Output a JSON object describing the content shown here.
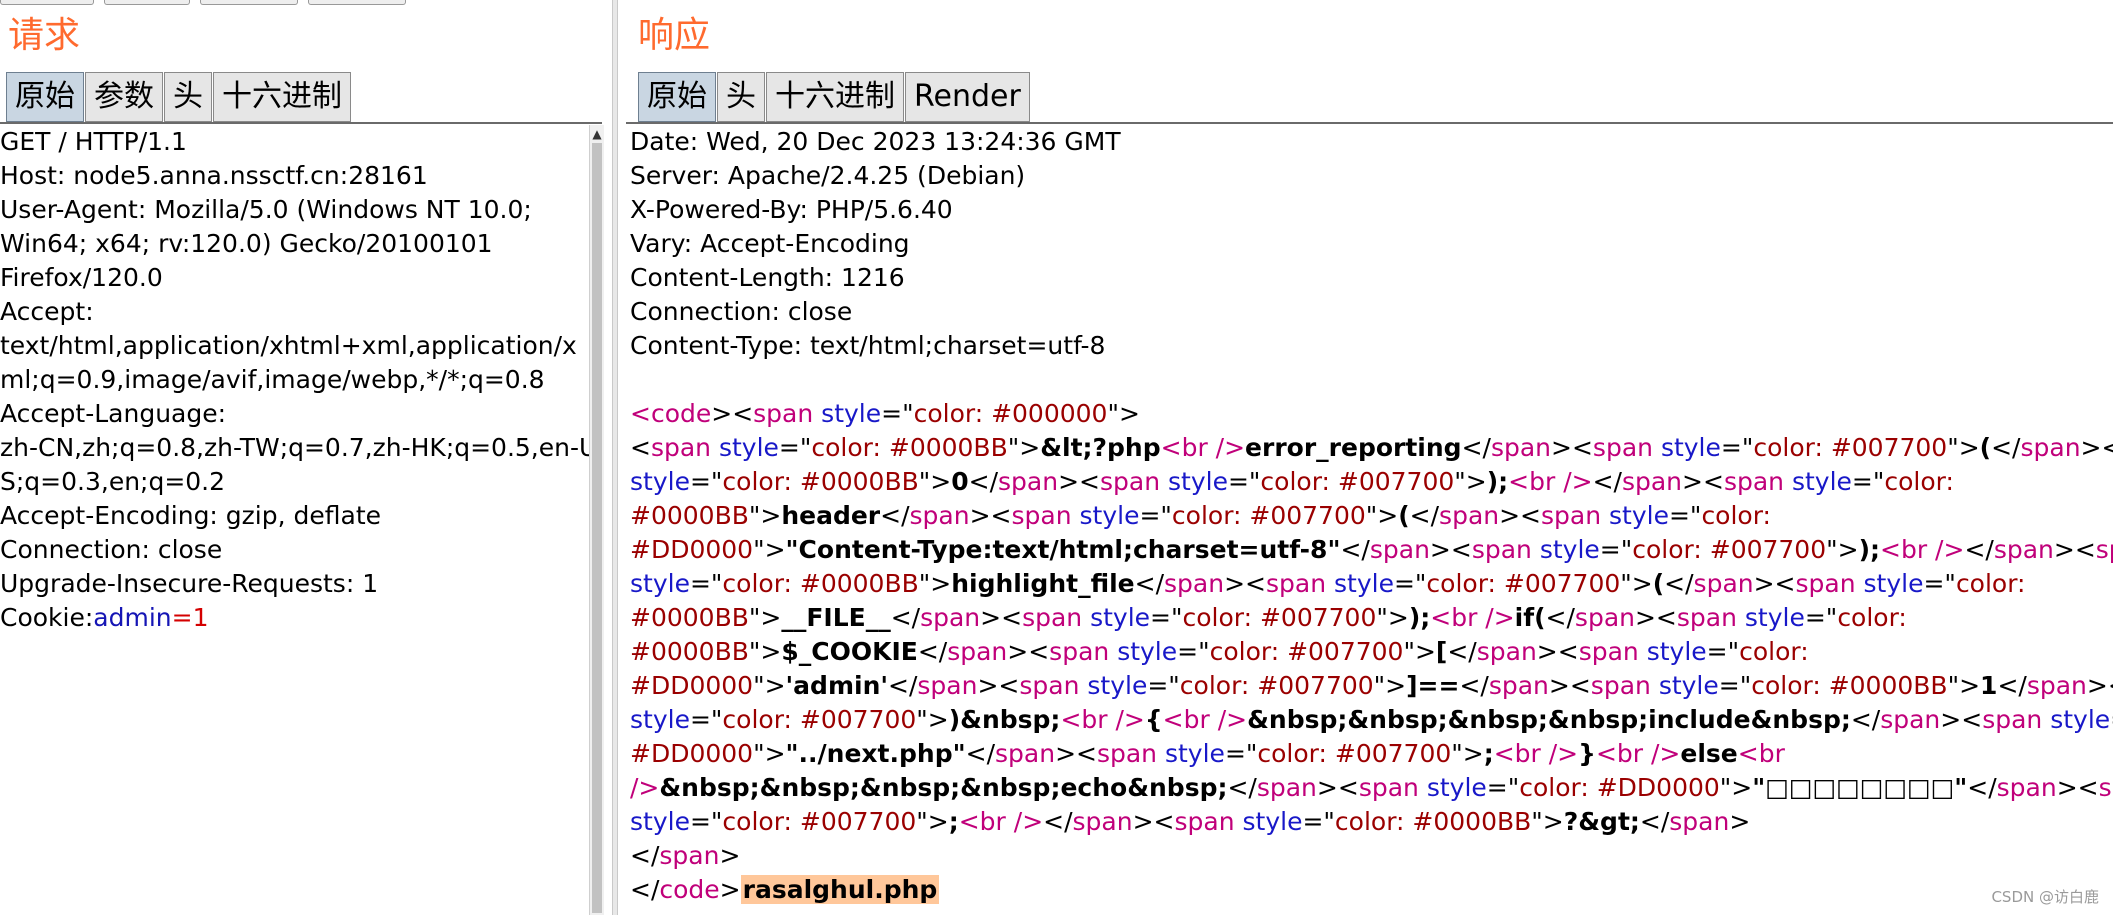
{
  "request": {
    "title": "请求",
    "tabs": [
      "原始",
      "参数",
      "头",
      "十六进制"
    ],
    "active_tab": "原始",
    "lines": [
      "GET / HTTP/1.1",
      "Host: node5.anna.nssctf.cn:28161",
      "User-Agent: Mozilla/5.0 (Windows NT 10.0;",
      "Win64; x64; rv:120.0) Gecko/20100101",
      "Firefox/120.0",
      "Accept:",
      "text/html,application/xhtml+xml,application/x",
      "ml;q=0.9,image/avif,image/webp,*/*;q=0.8",
      "Accept-Language:",
      "zh-CN,zh;q=0.8,zh-TW;q=0.7,zh-HK;q=0.5,en-U",
      "S;q=0.3,en;q=0.2",
      "Accept-Encoding: gzip, deflate",
      "Connection: close",
      "Upgrade-Insecure-Requests: 1"
    ],
    "cookie": {
      "label": "Cookie:",
      "key": "admin",
      "eq": "=",
      "value": "1"
    }
  },
  "response": {
    "title": "响应",
    "tabs": [
      "原始",
      "头",
      "十六进制",
      "Render"
    ],
    "active_tab": "原始",
    "headers": [
      "Date: Wed, 20 Dec 2023 13:24:36 GMT",
      "Server: Apache/2.4.25 (Debian)",
      "X-Powered-By: PHP/5.6.40",
      "Vary: Accept-Encoding",
      "Content-Length: 1216",
      "Connection: close",
      "Content-Type: text/html;charset=utf-8"
    ],
    "body_lines": [
      [
        [
          "t",
          "<code"
        ],
        [
          "p",
          "><"
        ],
        [
          "t",
          "span "
        ],
        [
          "a",
          "style"
        ],
        [
          "p",
          "=\""
        ],
        [
          "s",
          "color: #000000"
        ],
        [
          "p",
          "\">"
        ]
      ],
      [
        [
          "p",
          "<"
        ],
        [
          "t",
          "span "
        ],
        [
          "a",
          "style"
        ],
        [
          "p",
          "=\""
        ],
        [
          "s",
          "color: #0000BB"
        ],
        [
          "p",
          "\">"
        ],
        [
          "b",
          "&lt;?php"
        ],
        [
          "t",
          "<br />"
        ],
        [
          "b",
          "error_reporting"
        ],
        [
          "p",
          "</"
        ],
        [
          "t",
          "span"
        ],
        [
          "p",
          "><"
        ],
        [
          "t",
          "span "
        ],
        [
          "a",
          "style"
        ],
        [
          "p",
          "=\""
        ],
        [
          "s",
          "color: #007700"
        ],
        [
          "p",
          "\">"
        ],
        [
          "b",
          "("
        ],
        [
          "p",
          "</"
        ],
        [
          "t",
          "span"
        ],
        [
          "p",
          "><"
        ],
        [
          "t",
          "span"
        ]
      ],
      [
        [
          "a",
          "style"
        ],
        [
          "p",
          "=\""
        ],
        [
          "s",
          "color: #0000BB"
        ],
        [
          "p",
          "\">"
        ],
        [
          "b",
          "0"
        ],
        [
          "p",
          "</"
        ],
        [
          "t",
          "span"
        ],
        [
          "p",
          "><"
        ],
        [
          "t",
          "span "
        ],
        [
          "a",
          "style"
        ],
        [
          "p",
          "=\""
        ],
        [
          "s",
          "color: #007700"
        ],
        [
          "p",
          "\">"
        ],
        [
          "b",
          ");"
        ],
        [
          "t",
          "<br />"
        ],
        [
          "p",
          "</"
        ],
        [
          "t",
          "span"
        ],
        [
          "p",
          "><"
        ],
        [
          "t",
          "span "
        ],
        [
          "a",
          "style"
        ],
        [
          "p",
          "=\""
        ],
        [
          "s",
          "color:"
        ]
      ],
      [
        [
          "s",
          "#0000BB"
        ],
        [
          "p",
          "\">"
        ],
        [
          "b",
          "header"
        ],
        [
          "p",
          "</"
        ],
        [
          "t",
          "span"
        ],
        [
          "p",
          "><"
        ],
        [
          "t",
          "span "
        ],
        [
          "a",
          "style"
        ],
        [
          "p",
          "=\""
        ],
        [
          "s",
          "color: #007700"
        ],
        [
          "p",
          "\">"
        ],
        [
          "b",
          "("
        ],
        [
          "p",
          "</"
        ],
        [
          "t",
          "span"
        ],
        [
          "p",
          "><"
        ],
        [
          "t",
          "span "
        ],
        [
          "a",
          "style"
        ],
        [
          "p",
          "=\""
        ],
        [
          "s",
          "color:"
        ]
      ],
      [
        [
          "s",
          "#DD0000"
        ],
        [
          "p",
          "\">"
        ],
        [
          "b",
          "\"Content-Type:text/html;charset=utf-8\""
        ],
        [
          "p",
          "</"
        ],
        [
          "t",
          "span"
        ],
        [
          "p",
          "><"
        ],
        [
          "t",
          "span "
        ],
        [
          "a",
          "style"
        ],
        [
          "p",
          "=\""
        ],
        [
          "s",
          "color: #007700"
        ],
        [
          "p",
          "\">"
        ],
        [
          "b",
          ");"
        ],
        [
          "t",
          "<br />"
        ],
        [
          "p",
          "</"
        ],
        [
          "t",
          "span"
        ],
        [
          "p",
          "><"
        ],
        [
          "t",
          "span"
        ]
      ],
      [
        [
          "a",
          "style"
        ],
        [
          "p",
          "=\""
        ],
        [
          "s",
          "color: #0000BB"
        ],
        [
          "p",
          "\">"
        ],
        [
          "b",
          "highlight_file"
        ],
        [
          "p",
          "</"
        ],
        [
          "t",
          "span"
        ],
        [
          "p",
          "><"
        ],
        [
          "t",
          "span "
        ],
        [
          "a",
          "style"
        ],
        [
          "p",
          "=\""
        ],
        [
          "s",
          "color: #007700"
        ],
        [
          "p",
          "\">"
        ],
        [
          "b",
          "("
        ],
        [
          "p",
          "</"
        ],
        [
          "t",
          "span"
        ],
        [
          "p",
          "><"
        ],
        [
          "t",
          "span "
        ],
        [
          "a",
          "style"
        ],
        [
          "p",
          "=\""
        ],
        [
          "s",
          "color:"
        ]
      ],
      [
        [
          "s",
          "#0000BB"
        ],
        [
          "p",
          "\">"
        ],
        [
          "b",
          "__FILE__"
        ],
        [
          "p",
          "</"
        ],
        [
          "t",
          "span"
        ],
        [
          "p",
          "><"
        ],
        [
          "t",
          "span "
        ],
        [
          "a",
          "style"
        ],
        [
          "p",
          "=\""
        ],
        [
          "s",
          "color: #007700"
        ],
        [
          "p",
          "\">"
        ],
        [
          "b",
          ");"
        ],
        [
          "t",
          "<br />"
        ],
        [
          "b",
          "if("
        ],
        [
          "p",
          "</"
        ],
        [
          "t",
          "span"
        ],
        [
          "p",
          "><"
        ],
        [
          "t",
          "span "
        ],
        [
          "a",
          "style"
        ],
        [
          "p",
          "=\""
        ],
        [
          "s",
          "color:"
        ]
      ],
      [
        [
          "s",
          "#0000BB"
        ],
        [
          "p",
          "\">"
        ],
        [
          "b",
          "$_COOKIE"
        ],
        [
          "p",
          "</"
        ],
        [
          "t",
          "span"
        ],
        [
          "p",
          "><"
        ],
        [
          "t",
          "span "
        ],
        [
          "a",
          "style"
        ],
        [
          "p",
          "=\""
        ],
        [
          "s",
          "color: #007700"
        ],
        [
          "p",
          "\">"
        ],
        [
          "b",
          "["
        ],
        [
          "p",
          "</"
        ],
        [
          "t",
          "span"
        ],
        [
          "p",
          "><"
        ],
        [
          "t",
          "span "
        ],
        [
          "a",
          "style"
        ],
        [
          "p",
          "=\""
        ],
        [
          "s",
          "color:"
        ]
      ],
      [
        [
          "s",
          "#DD0000"
        ],
        [
          "p",
          "\">"
        ],
        [
          "b",
          "'admin'"
        ],
        [
          "p",
          "</"
        ],
        [
          "t",
          "span"
        ],
        [
          "p",
          "><"
        ],
        [
          "t",
          "span "
        ],
        [
          "a",
          "style"
        ],
        [
          "p",
          "=\""
        ],
        [
          "s",
          "color: #007700"
        ],
        [
          "p",
          "\">"
        ],
        [
          "b",
          "]=="
        ],
        [
          "p",
          "</"
        ],
        [
          "t",
          "span"
        ],
        [
          "p",
          "><"
        ],
        [
          "t",
          "span "
        ],
        [
          "a",
          "style"
        ],
        [
          "p",
          "=\""
        ],
        [
          "s",
          "color: #0000BB"
        ],
        [
          "p",
          "\">"
        ],
        [
          "b",
          "1"
        ],
        [
          "p",
          "</"
        ],
        [
          "t",
          "span"
        ],
        [
          "p",
          "><"
        ],
        [
          "t",
          "span"
        ]
      ],
      [
        [
          "a",
          "style"
        ],
        [
          "p",
          "=\""
        ],
        [
          "s",
          "color: #007700"
        ],
        [
          "p",
          "\">"
        ],
        [
          "b",
          ")&nbsp;"
        ],
        [
          "t",
          "<br />"
        ],
        [
          "b",
          "{"
        ],
        [
          "t",
          "<br />"
        ],
        [
          "b",
          "&nbsp;&nbsp;&nbsp;&nbsp;include&nbsp;"
        ],
        [
          "p",
          "</"
        ],
        [
          "t",
          "span"
        ],
        [
          "p",
          "><"
        ],
        [
          "t",
          "span "
        ],
        [
          "a",
          "style"
        ],
        [
          "p",
          "=\""
        ],
        [
          "s",
          "color:"
        ]
      ],
      [
        [
          "s",
          "#DD0000"
        ],
        [
          "p",
          "\">"
        ],
        [
          "b",
          "\"../next.php\""
        ],
        [
          "p",
          "</"
        ],
        [
          "t",
          "span"
        ],
        [
          "p",
          "><"
        ],
        [
          "t",
          "span "
        ],
        [
          "a",
          "style"
        ],
        [
          "p",
          "=\""
        ],
        [
          "s",
          "color: #007700"
        ],
        [
          "p",
          "\">"
        ],
        [
          "b",
          ";"
        ],
        [
          "t",
          "<br />"
        ],
        [
          "b",
          "}"
        ],
        [
          "t",
          "<br />"
        ],
        [
          "b",
          "else"
        ],
        [
          "t",
          "<br"
        ]
      ],
      [
        [
          "t",
          "/>"
        ],
        [
          "b",
          "&nbsp;&nbsp;&nbsp;&nbsp;echo&nbsp;"
        ],
        [
          "p",
          "</"
        ],
        [
          "t",
          "span"
        ],
        [
          "p",
          "><"
        ],
        [
          "t",
          "span "
        ],
        [
          "a",
          "style"
        ],
        [
          "p",
          "=\""
        ],
        [
          "s",
          "color: #DD0000"
        ],
        [
          "p",
          "\">"
        ],
        [
          "b",
          "\"□□□□□□□□\""
        ],
        [
          "p",
          "</"
        ],
        [
          "t",
          "span"
        ],
        [
          "p",
          "><"
        ],
        [
          "t",
          "span"
        ]
      ],
      [
        [
          "a",
          "style"
        ],
        [
          "p",
          "=\""
        ],
        [
          "s",
          "color: #007700"
        ],
        [
          "p",
          "\">"
        ],
        [
          "b",
          ";"
        ],
        [
          "t",
          "<br />"
        ],
        [
          "p",
          "</"
        ],
        [
          "t",
          "span"
        ],
        [
          "p",
          "><"
        ],
        [
          "t",
          "span "
        ],
        [
          "a",
          "style"
        ],
        [
          "p",
          "=\""
        ],
        [
          "s",
          "color: #0000BB"
        ],
        [
          "p",
          "\">"
        ],
        [
          "b",
          "?&gt;"
        ],
        [
          "p",
          "</"
        ],
        [
          "t",
          "span"
        ],
        [
          "p",
          ">"
        ]
      ],
      [
        [
          "p",
          "</"
        ],
        [
          "t",
          "span"
        ],
        [
          "p",
          ">"
        ]
      ],
      [
        [
          "p",
          "</"
        ],
        [
          "t",
          "code"
        ],
        [
          "p",
          ">"
        ],
        [
          "hl",
          "rasalghul.php"
        ]
      ]
    ]
  },
  "watermark": "CSDN @访白鹿"
}
